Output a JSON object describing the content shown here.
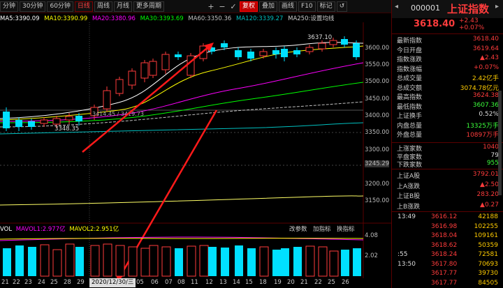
{
  "toolbar": {
    "buttons": [
      {
        "label": "分钟",
        "active": false
      },
      {
        "label": "30分钟",
        "active": false
      },
      {
        "label": "60分钟",
        "active": false
      },
      {
        "label": "日线",
        "active": true
      },
      {
        "label": "周线",
        "active": false
      },
      {
        "label": "月线",
        "active": false
      },
      {
        "label": "更多周期",
        "active": false
      }
    ],
    "icons": [
      "+",
      "−",
      "✓"
    ],
    "right_buttons": [
      {
        "label": "复权",
        "style": "red"
      },
      {
        "label": "叠加",
        "style": "normal"
      },
      {
        "label": "画线",
        "style": "normal"
      },
      {
        "label": "F10",
        "style": "normal"
      },
      {
        "label": "标记",
        "style": "normal"
      },
      {
        "label": "↺",
        "style": "normal"
      }
    ]
  },
  "ma": {
    "ma5": "MA5:3390.09",
    "ma10": "MA10:3390.99",
    "ma20": "MA20:3380.96",
    "ma30": "MA30:3393.69",
    "ma60": "MA60:3350.36",
    "ma120": "MA120:3339.27",
    "ma250": "MA250:设置均线"
  },
  "axis": {
    "labels": [
      "3600.00",
      "3550.00",
      "3500.00",
      "3450.00",
      "3400.00",
      "3350.00",
      "3300.00",
      "3245.29",
      "3200.00",
      "3150.00"
    ],
    "vol_labels": [
      "4.08",
      "2.02"
    ]
  },
  "annotations": {
    "high_label": "3637.10",
    "low_label": "3348.35",
    "mid_label": "3414.45 / 3419.73"
  },
  "volume": {
    "header_vol": "VOL",
    "mavol1": "MAVOL1:2.977亿",
    "mavol2": "MAVOL2:2.951亿",
    "tabs": [
      "改参数",
      "加指标",
      "换指标"
    ]
  },
  "dates": {
    "left": [
      "21",
      "22",
      "23",
      "24",
      "25",
      "28",
      "29"
    ],
    "current": "2020/12/30/三",
    "right": [
      "05",
      "06",
      "07",
      "08",
      "11",
      "12",
      "13",
      "14",
      "15",
      "18",
      "19",
      "20",
      "21",
      "22",
      "25",
      "26"
    ]
  },
  "panel": {
    "code": "000001",
    "name": "上证指数",
    "price": "3618.40",
    "change": "+2.43",
    "change_pct": "+0.07%",
    "stats": [
      {
        "k": "最新指数",
        "v": "3618.40",
        "c": "red"
      },
      {
        "k": "今日开盘",
        "v": "3619.64",
        "c": "red"
      },
      {
        "k": "指数涨跌",
        "v": "▲2.43",
        "c": "red"
      },
      {
        "k": "指数涨幅",
        "v": "+0.07%",
        "c": "red"
      },
      {
        "k": "总成交量",
        "v": "2.42亿手",
        "c": "yel"
      },
      {
        "k": "总成交额",
        "v": "3074.78亿元",
        "c": "yel"
      },
      {
        "k": "最高指数",
        "v": "3624.38",
        "c": "red"
      },
      {
        "k": "最低指数",
        "v": "3607.36",
        "c": "grn"
      },
      {
        "k": "上证换手",
        "v": "0.52%",
        "c": "wht"
      },
      {
        "k": "内盘总量",
        "v": "13325万手",
        "c": "grn"
      },
      {
        "k": "外盘总量",
        "v": "10897万手",
        "c": "red"
      }
    ],
    "stats2": [
      {
        "k": "上涨家数",
        "v": "1040",
        "c": "red"
      },
      {
        "k": "平盘家数",
        "v": "79",
        "c": "wht"
      },
      {
        "k": "下跌家数",
        "v": "955",
        "c": "grn"
      }
    ],
    "stats3": [
      {
        "k": "上证A股",
        "v": "3792.01",
        "c": "red"
      },
      {
        "k": "上A涨跌",
        "v": "▲2.50",
        "c": "red"
      },
      {
        "k": "上证B股",
        "v": "283.20",
        "c": "red"
      },
      {
        "k": "上B涨跌",
        "v": "▲0.27",
        "c": "red"
      }
    ],
    "ticks": [
      {
        "t": "13:49",
        "p": "3616.12",
        "v": "42188"
      },
      {
        "t": "",
        "p": "3616.98",
        "v": "102255"
      },
      {
        "t": "",
        "p": "3618.04",
        "v": "109161"
      },
      {
        "t": "",
        "p": "3618.62",
        "v": "50359"
      },
      {
        "t": ":55",
        "p": "3618.24",
        "v": "72581"
      },
      {
        "t": "13:50",
        "p": "3617.80",
        "v": "70693"
      },
      {
        "t": "",
        "p": "3617.77",
        "v": "39730"
      },
      {
        "t": "",
        "p": "3617.77",
        "v": "84505"
      }
    ]
  },
  "colors": {
    "up": "#ff3c3c",
    "down": "#00e0ff",
    "ma5": "#ffffff",
    "ma10": "#ffff00",
    "ma20": "#ff00ff",
    "ma30": "#00ff00",
    "ma60": "#c0c0c0",
    "ma120": "#00c0c0"
  }
}
